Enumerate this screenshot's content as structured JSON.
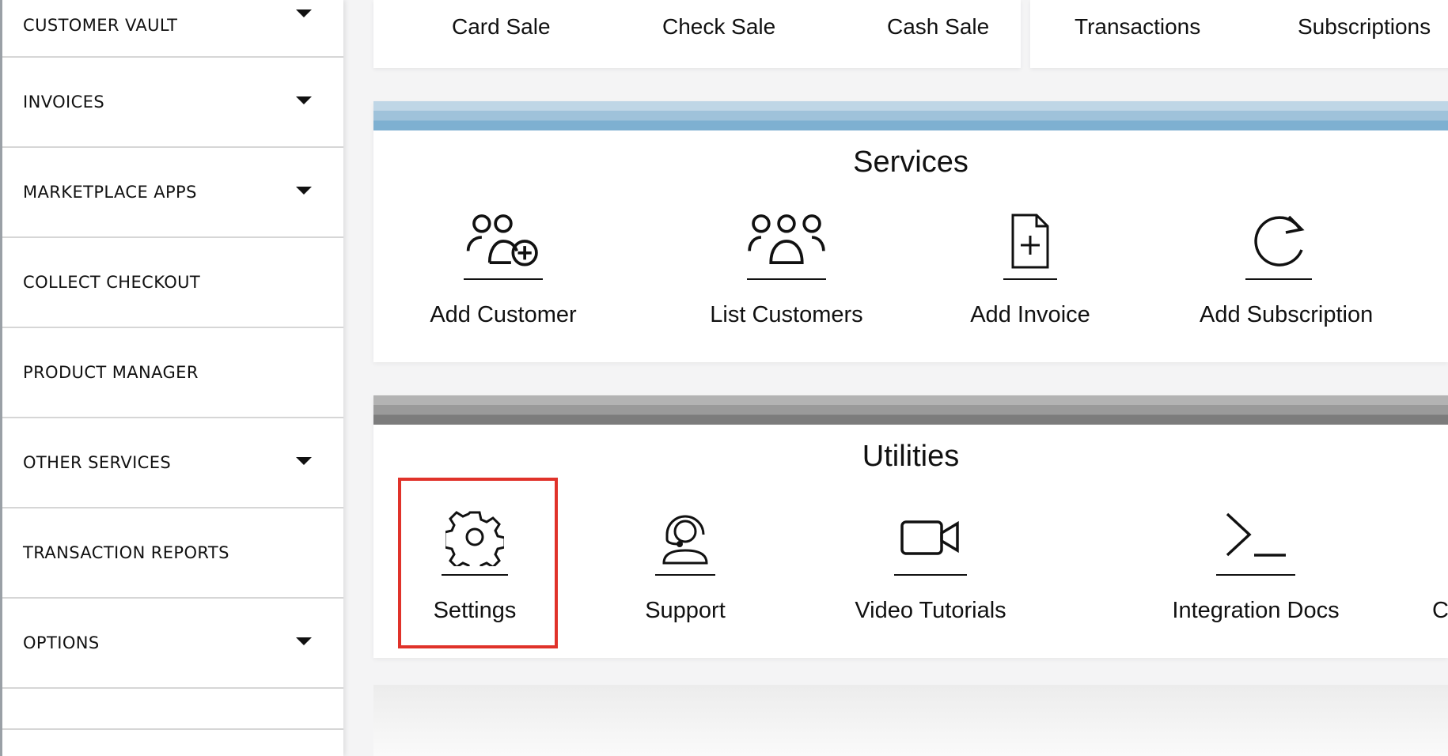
{
  "sidebar": {
    "items": [
      {
        "label": "CUSTOMER VAULT",
        "has_caret": true
      },
      {
        "label": "INVOICES",
        "has_caret": true
      },
      {
        "label": "MARKETPLACE APPS",
        "has_caret": true
      },
      {
        "label": "COLLECT CHECKOUT",
        "has_caret": false
      },
      {
        "label": "PRODUCT MANAGER",
        "has_caret": false
      },
      {
        "label": "OTHER SERVICES",
        "has_caret": true
      },
      {
        "label": "TRANSACTION REPORTS",
        "has_caret": false
      },
      {
        "label": "OPTIONS",
        "has_caret": true
      }
    ]
  },
  "topbar": {
    "left_links": [
      "Card Sale",
      "Check Sale",
      "Cash Sale"
    ],
    "right_links": [
      "Transactions",
      "Subscriptions"
    ]
  },
  "services": {
    "title": "Services",
    "stripe_color": "#7eb0d1",
    "tiles": [
      {
        "label": "Add Customer",
        "icon": "add-customer-icon"
      },
      {
        "label": "List Customers",
        "icon": "customers-group-icon"
      },
      {
        "label": "Add Invoice",
        "icon": "add-document-icon"
      },
      {
        "label": "Add Subscription",
        "icon": "refresh-icon"
      }
    ]
  },
  "utilities": {
    "title": "Utilities",
    "stripe_color": "#7c7c7c",
    "tiles": [
      {
        "label": "Settings",
        "icon": "gear-icon",
        "highlighted": true
      },
      {
        "label": "Support",
        "icon": "headset-icon"
      },
      {
        "label": "Video Tutorials",
        "icon": "video-camera-icon"
      },
      {
        "label": "Integration Docs",
        "icon": "terminal-icon"
      },
      {
        "label": "C",
        "icon": ""
      }
    ]
  },
  "colors": {
    "highlight": "#e0322a",
    "text": "#111111"
  }
}
